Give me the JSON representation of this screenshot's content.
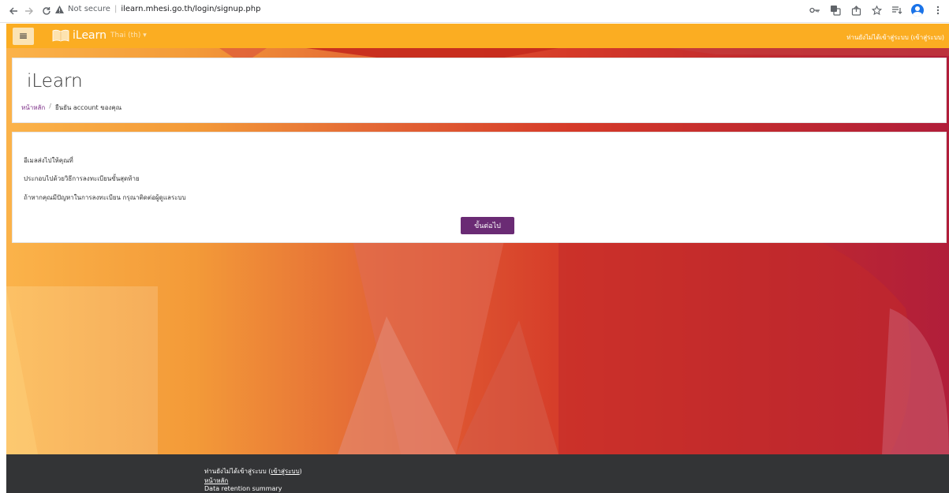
{
  "browser": {
    "security_label": "Not secure",
    "url": "ilearn.mhesi.go.th/login/signup.php",
    "icons": [
      "back-icon",
      "forward-icon",
      "reload-icon",
      "warning-icon",
      "key-icon",
      "translate-icon",
      "share-icon",
      "star-icon",
      "reading-list-icon",
      "profile-icon",
      "menu-icon"
    ]
  },
  "navbar": {
    "brand": "iLearn",
    "language": "Thai (th)",
    "login_status": "ท่านยังไม่ได้เข้าสู่ระบบ (เข้าสู่ระบบ)",
    "colors": {
      "background": "#fbad22"
    }
  },
  "header": {
    "title": "iLearn",
    "breadcrumb": {
      "home": "หน้าหลัก",
      "separator": "/",
      "current": "ยืนยัน account ของคุณ"
    }
  },
  "main": {
    "messages": [
      "อีเมลส่งไปให้คุณที่",
      "ประกอบไปด้วยวิธีการลงทะเบียนขั้นสุดท้าย",
      "ถ้าหากคุณมีปัญหาในการลงทะเบียน กรุณาติดต่อผู้ดูแลระบบ"
    ],
    "continue_button": "ขั้นต่อไป",
    "colors": {
      "button": "#6a2b74"
    }
  },
  "footer": {
    "login_prefix": "ท่านยังไม่ได้เข้าสู่ระบบ (",
    "login_link": "เข้าสู่ระบบ",
    "login_suffix": ")",
    "home_link": "หน้าหลัก",
    "data_retention": "Data retention summary"
  }
}
